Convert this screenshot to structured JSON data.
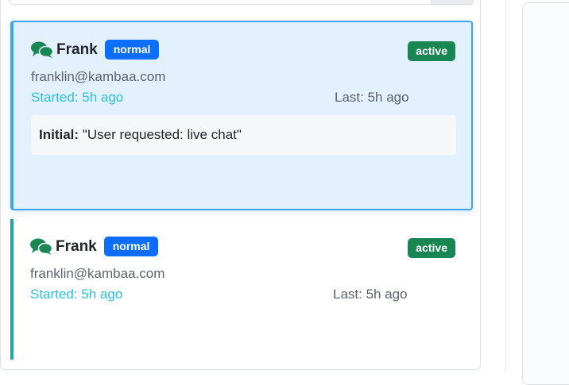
{
  "conversations": [
    {
      "name": "Frank",
      "priority": "normal",
      "status": "active",
      "email": "franklin@kambaa.com",
      "started": "Started: 5h ago",
      "last": "Last: 5h ago",
      "initial_label": "Initial:",
      "initial_text": "\"User requested: live chat\"",
      "selected": true
    },
    {
      "name": "Frank",
      "priority": "normal",
      "status": "active",
      "email": "franklin@kambaa.com",
      "started": "Started: 5h ago",
      "last": "Last: 5h ago",
      "selected": false
    }
  ],
  "colors": {
    "priority_badge": "#0d6efd",
    "status_badge": "#198754",
    "chat_icon": "#198754",
    "selected_border": "#3ea6e6",
    "started_text": "#2bc0dc"
  },
  "icons": {
    "chat": "chat-bubbles-icon"
  }
}
